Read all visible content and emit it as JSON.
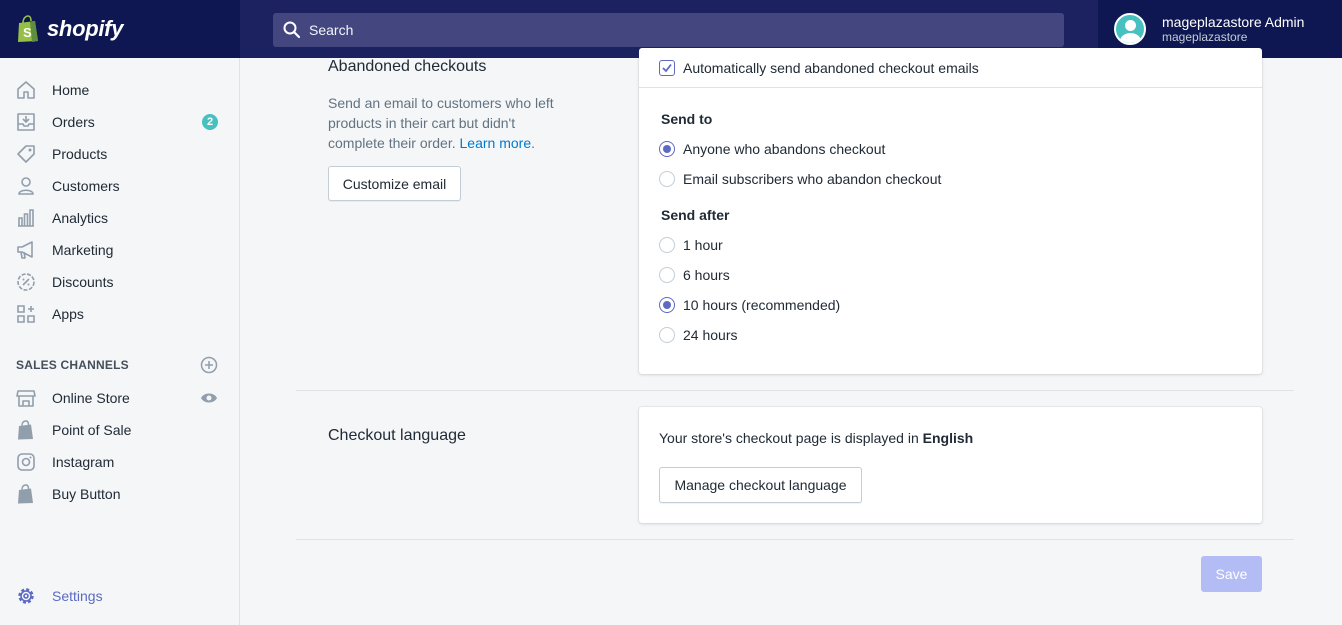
{
  "brand": {
    "name": "shopify",
    "color": "#0e1751"
  },
  "search": {
    "placeholder": "Search"
  },
  "user": {
    "name": "mageplazastore Admin",
    "store": "mageplazastore"
  },
  "sidebar": {
    "items": [
      {
        "label": "Home",
        "icon": "home-icon"
      },
      {
        "label": "Orders",
        "icon": "orders-icon",
        "badge": "2"
      },
      {
        "label": "Products",
        "icon": "tag-icon"
      },
      {
        "label": "Customers",
        "icon": "person-icon"
      },
      {
        "label": "Analytics",
        "icon": "bar-chart-icon"
      },
      {
        "label": "Marketing",
        "icon": "megaphone-icon"
      },
      {
        "label": "Discounts",
        "icon": "discount-icon"
      },
      {
        "label": "Apps",
        "icon": "apps-icon"
      }
    ],
    "sales_channels_title": "SALES CHANNELS",
    "channels": [
      {
        "label": "Online Store",
        "icon": "store-icon"
      },
      {
        "label": "Point of Sale",
        "icon": "shopify-bag-icon"
      },
      {
        "label": "Instagram",
        "icon": "instagram-icon"
      },
      {
        "label": "Buy Button",
        "icon": "shopify-bag-icon"
      }
    ],
    "settings_label": "Settings"
  },
  "abandoned": {
    "title": "Abandoned checkouts",
    "description": "Send an email to customers who left products in their cart but didn't complete their order.",
    "learn_more": "Learn more",
    "customize_button": "Customize email",
    "auto_send_label": "Automatically send abandoned checkout emails",
    "auto_send_checked": true,
    "send_to_title": "Send to",
    "send_to_options": [
      {
        "label": "Anyone who abandons checkout",
        "selected": true
      },
      {
        "label": "Email subscribers who abandon checkout",
        "selected": false
      }
    ],
    "send_after_title": "Send after",
    "send_after_options": [
      {
        "label": "1 hour",
        "selected": false
      },
      {
        "label": "6 hours",
        "selected": false
      },
      {
        "label": "10 hours (recommended)",
        "selected": true
      },
      {
        "label": "24 hours",
        "selected": false
      }
    ]
  },
  "language": {
    "title": "Checkout language",
    "text_prefix": "Your store's checkout page is displayed in",
    "language_name": "English",
    "manage_button": "Manage checkout language"
  },
  "save_button": "Save",
  "colors": {
    "accent": "#5c6ac4",
    "topbar": "#1c2260",
    "badge": "#47c1bf",
    "save_disabled": "#b3bcf5"
  }
}
